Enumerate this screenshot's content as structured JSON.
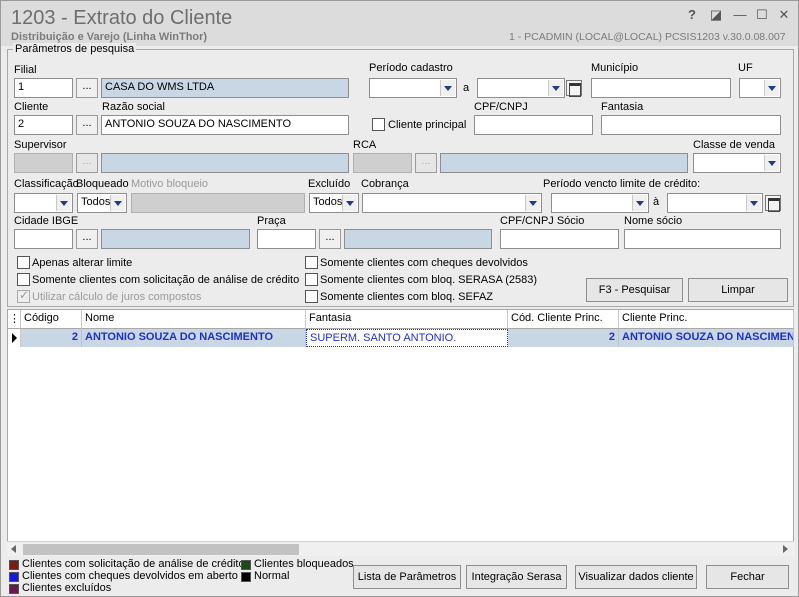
{
  "window": {
    "title": "1203 - Extrato do Cliente",
    "subtitle": "Distribuição e Varejo (Linha WinThor)",
    "userinfo": "1 - PCADMIN (LOCAL@LOCAL)   PCSIS1203  v.30.0.08.007",
    "help_glyph": "?",
    "restore_glyph": "◪",
    "min_glyph": "—",
    "max_glyph": "☐",
    "close_glyph": "✕"
  },
  "params": {
    "group_label": "Parâmetros de pesquisa",
    "filial": {
      "label": "Filial",
      "code": "1",
      "name": "CASA DO WMS LTDA"
    },
    "periodo_cadastro": {
      "label": "Período cadastro",
      "sep": "a",
      "from": "",
      "to": ""
    },
    "municipio": {
      "label": "Município",
      "value": ""
    },
    "uf": {
      "label": "UF",
      "value": ""
    },
    "cliente": {
      "label": "Cliente",
      "code": "2"
    },
    "razao_social": {
      "label": "Razão social",
      "value": "ANTONIO SOUZA DO NASCIMENTO"
    },
    "cliente_principal": {
      "label": "Cliente principal",
      "checked": false
    },
    "cpf_cnpj": {
      "label": "CPF/CNPJ",
      "value": ""
    },
    "fantasia": {
      "label": "Fantasia",
      "value": ""
    },
    "supervisor": {
      "label": "Supervisor"
    },
    "rca": {
      "label": "RCA"
    },
    "classe_venda": {
      "label": "Classe de venda",
      "value": ""
    },
    "classificacao": {
      "label": "Classificação",
      "value": ""
    },
    "bloqueado": {
      "label": "Bloqueado",
      "value": "Todos"
    },
    "motivo_bloqueio": {
      "label": "Motivo bloqueio"
    },
    "excluido": {
      "label": "Excluído",
      "value": "Todos"
    },
    "cobranca": {
      "label": "Cobrança",
      "value": ""
    },
    "periodo_vencto": {
      "label": "Período vencto limite de crédito:",
      "sep": "à"
    },
    "cidade_ibge": {
      "label": "Cidade IBGE"
    },
    "praca": {
      "label": "Praça"
    },
    "cpf_cnpj_socio": {
      "label": "CPF/CNPJ Sócio"
    },
    "nome_socio": {
      "label": "Nome sócio"
    },
    "ellipsis": "...",
    "checkboxes": {
      "apenas_alterar_limite": "Apenas alterar limite",
      "solicitacao_analise": "Somente clientes com solicitação de análise de crédito",
      "juros_compostos": "Utilizar cálculo de juros compostos",
      "cheques_devolvidos": "Somente clientes com cheques devolvidos",
      "bloq_serasa": "Somente clientes com bloq. SERASA (2583)",
      "bloq_sefaz": "Somente clientes com bloq. SEFAZ"
    },
    "pesquisar_label": "F3 - Pesquisar",
    "limpar_label": "Limpar"
  },
  "grid": {
    "columns": [
      "Código",
      "Nome",
      "Fantasia",
      "Cód. Cliente Princ.",
      "Cliente Princ."
    ],
    "rows": [
      {
        "codigo": "2",
        "nome": "ANTONIO SOUZA DO NASCIMENTO",
        "fantasia": "SUPERM. SANTO ANTONIO.",
        "cod_princ": "2",
        "cliente_princ": "ANTONIO SOUZA DO NASCIMENTO"
      }
    ]
  },
  "legend": [
    {
      "label": "Clientes com solicitação de análise de crédito",
      "color": "#7a1a1a"
    },
    {
      "label": "Clientes com cheques devolvidos em aberto",
      "color": "#1a1ad8"
    },
    {
      "label": "Clientes excluídos",
      "color": "#6a1a4a"
    },
    {
      "label": "Clientes bloqueados",
      "color": "#1a4a1a"
    },
    {
      "label": "Normal",
      "color": "#000000"
    }
  ],
  "footer": {
    "lista_parametros": "Lista de Parâmetros",
    "integracao_serasa": "Integração Serasa",
    "visualizar_dados": "Visualizar dados cliente",
    "fechar": "Fechar"
  }
}
